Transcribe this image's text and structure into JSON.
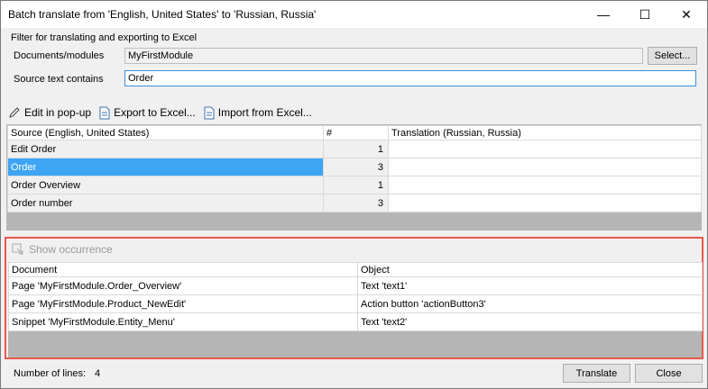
{
  "window": {
    "title": "Batch translate from 'English, United States' to 'Russian, Russia'",
    "minimize_glyph": "—",
    "maximize_glyph": "☐",
    "close_glyph": "✕"
  },
  "filter": {
    "legend": "Filter for translating and exporting to Excel",
    "documents_label": "Documents/modules",
    "documents_value": "MyFirstModule",
    "select_button": "Select...",
    "source_label": "Source text contains",
    "source_value": "Order"
  },
  "toolbar": {
    "edit_label": "Edit in pop-up",
    "export_label": "Export to Excel...",
    "import_label": "Import from Excel..."
  },
  "translation_table": {
    "headers": [
      "Source (English, United States)",
      "#",
      "Translation (Russian, Russia)"
    ],
    "rows": [
      {
        "source": "Edit Order",
        "count": "1",
        "translation": ""
      },
      {
        "source": "Order",
        "count": "3",
        "translation": ""
      },
      {
        "source": "Order Overview",
        "count": "1",
        "translation": ""
      },
      {
        "source": "Order number",
        "count": "3",
        "translation": ""
      }
    ],
    "selected_row": 1,
    "selection_color": "#3ea5f4"
  },
  "occurrence": {
    "show_label": "Show occurrence",
    "headers": [
      "Document",
      "Object"
    ],
    "rows": [
      {
        "document": "Page 'MyFirstModule.Order_Overview'",
        "object": "Text 'text1'"
      },
      {
        "document": "Page 'MyFirstModule.Product_NewEdit'",
        "object": "Action button 'actionButton3'"
      },
      {
        "document": "Snippet 'MyFirstModule.Entity_Menu'",
        "object": "Text 'text2'"
      }
    ],
    "highlight_color": "#e8584a"
  },
  "footer": {
    "lines_label": "Number of lines:",
    "lines_value": "4",
    "translate_button": "Translate",
    "close_button": "Close"
  }
}
